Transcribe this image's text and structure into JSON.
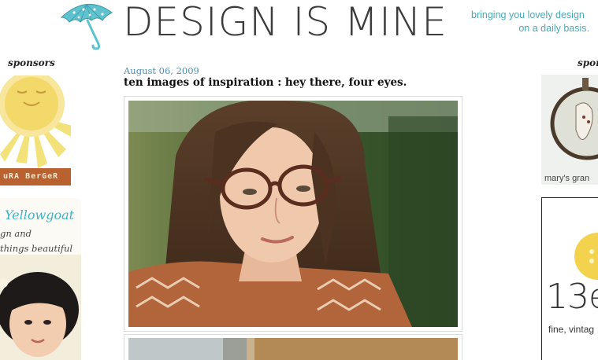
{
  "header": {
    "site_title": "DESIGN IS MINE",
    "tagline_line1": "bringing you lovely design",
    "tagline_line2": "on a daily basis."
  },
  "left_sidebar": {
    "heading": "sponsors",
    "ads": [
      {
        "label": "uRA BerGeR"
      },
      {
        "title": "Yellowgoat",
        "line1": "gn and",
        "line2": "things beautiful"
      }
    ]
  },
  "post": {
    "date": "August 06, 2009",
    "title": "ten images of inspiration : hey there, four eyes."
  },
  "right_sidebar": {
    "heading": "sponsors",
    "ads": [
      {
        "label": "mary's gran"
      },
      {
        "logo": "13e",
        "tagline": "fine, vintag"
      }
    ]
  },
  "colors": {
    "tagline": "#4da8b4",
    "date": "#4d8fb0",
    "umbrella": "#5fc3cf",
    "sun_ad_label_bg": "#b9612f",
    "button_yellow": "#f3d24e"
  },
  "icons": [
    "umbrella-logo-icon"
  ]
}
